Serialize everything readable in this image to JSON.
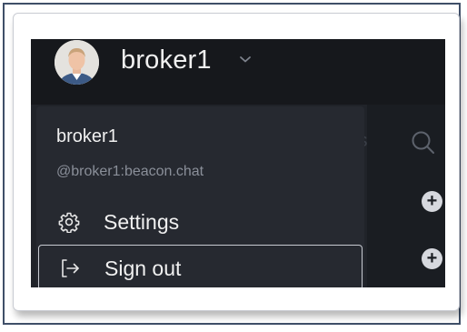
{
  "header": {
    "username": "broker1"
  },
  "menu": {
    "display_name": "broker1",
    "user_id": "@broker1:beacon.chat",
    "items": [
      {
        "label": "Settings",
        "icon": "gear-icon"
      },
      {
        "label": "Sign out",
        "icon": "sign-out-icon"
      }
    ]
  },
  "background": {
    "partial_text": "s"
  },
  "colors": {
    "app_background": "#1c1f25",
    "top_bar": "#16181c",
    "menu_background": "#262930",
    "primary_text": "#f0f0f0",
    "secondary_text": "#8a8f99",
    "frame_border": "#3f4f68"
  }
}
